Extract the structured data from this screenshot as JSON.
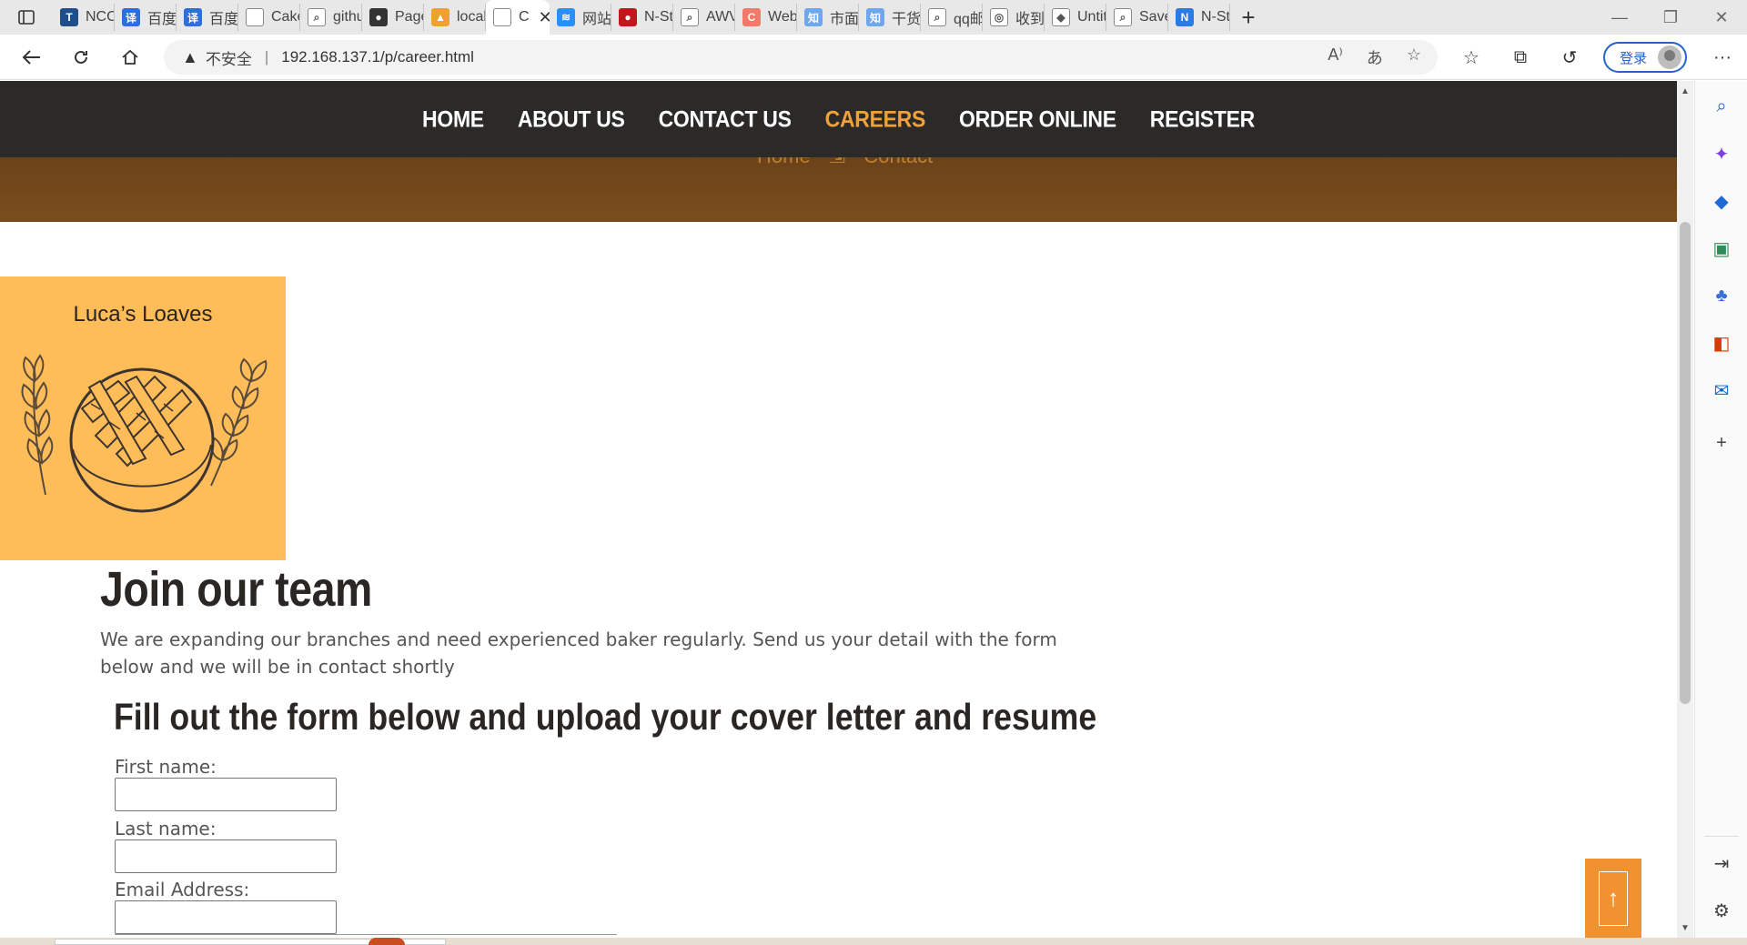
{
  "browser": {
    "tabs": [
      {
        "title": "NCC -",
        "fav": "NCC-favicon",
        "color": "#1f4e8c",
        "glyph": "T"
      },
      {
        "title": "百度翻",
        "fav": "baidu-translate-favicon",
        "color": "#2a6fdb",
        "glyph": "译"
      },
      {
        "title": "百度翻",
        "fav": "baidu-translate-favicon",
        "color": "#2a6fdb",
        "glyph": "译"
      },
      {
        "title": "Cake:",
        "fav": "page-favicon",
        "color": "#ffffff",
        "glyph": ""
      },
      {
        "title": "githu",
        "fav": "search-favicon",
        "color": "#ffffff",
        "glyph": "⌕"
      },
      {
        "title": "Pages",
        "fav": "github-favicon",
        "color": "#333333",
        "glyph": "●"
      },
      {
        "title": "localh",
        "fav": "phpmyadmin-favicon",
        "color": "#f0a030",
        "glyph": "▲"
      },
      {
        "title": "C",
        "fav": "page-favicon",
        "color": "#ffffff",
        "glyph": "",
        "active": true
      },
      {
        "title": "网站",
        "fav": "layers-favicon",
        "color": "#2c8ef8",
        "glyph": "≋"
      },
      {
        "title": "N-Sta",
        "fav": "nsta-favicon",
        "color": "#c0161c",
        "glyph": "●"
      },
      {
        "title": "AWVS",
        "fav": "search-favicon",
        "color": "#ffffff",
        "glyph": "⌕"
      },
      {
        "title": "Web",
        "fav": "web-favicon",
        "color": "#f27a6b",
        "glyph": "C"
      },
      {
        "title": "市面",
        "fav": "zhihu-favicon",
        "color": "#6fa7ef",
        "glyph": "知"
      },
      {
        "title": "干货",
        "fav": "zhihu-favicon",
        "color": "#6fa7ef",
        "glyph": "知"
      },
      {
        "title": "qq邮",
        "fav": "search-favicon",
        "color": "#ffffff",
        "glyph": "⌕"
      },
      {
        "title": "收到",
        "fav": "chrome-favicon",
        "color": "#ffffff",
        "glyph": "◎"
      },
      {
        "title": "Untit",
        "fav": "figma-favicon",
        "color": "#ffffff",
        "glyph": "◆"
      },
      {
        "title": "Save",
        "fav": "search-favicon",
        "color": "#ffffff",
        "glyph": "⌕"
      },
      {
        "title": "N-Sta",
        "fav": "nsta-favicon",
        "color": "#2a7be4",
        "glyph": "N"
      }
    ],
    "address": {
      "security": "不安全",
      "url": "192.168.137.1/p/career.html"
    },
    "login_label": "登录"
  },
  "site": {
    "nav": [
      {
        "label": "HOME",
        "current": false
      },
      {
        "label": "ABOUT US",
        "current": false
      },
      {
        "label": "CONTACT US",
        "current": false
      },
      {
        "label": "CAREERS",
        "current": true
      },
      {
        "label": "ORDER ONLINE",
        "current": false
      },
      {
        "label": "REGISTER",
        "current": false
      }
    ],
    "breadcrumb": {
      "home": "Home",
      "current": "Contact"
    },
    "logo_text": "Luca’s Loaves",
    "heading": "Join our team",
    "intro": "We are expanding our branches and need experienced baker regularly. Send us your detail with the form below and we will be in contact shortly",
    "form_heading": "Fill out the form below and upload your cover letter and resume",
    "fields": {
      "first_name": {
        "label": "First name:",
        "value": ""
      },
      "last_name": {
        "label": "Last name:",
        "value": ""
      },
      "email": {
        "label": "Email Address:",
        "value": ""
      }
    },
    "to_top_icon": "arrow-up-icon",
    "colors": {
      "nav_bg": "#2b2a28",
      "accent": "#f0a238",
      "hero": "#6b4318",
      "logo_bg": "#ffbd59",
      "to_top": "#f0922f"
    }
  }
}
